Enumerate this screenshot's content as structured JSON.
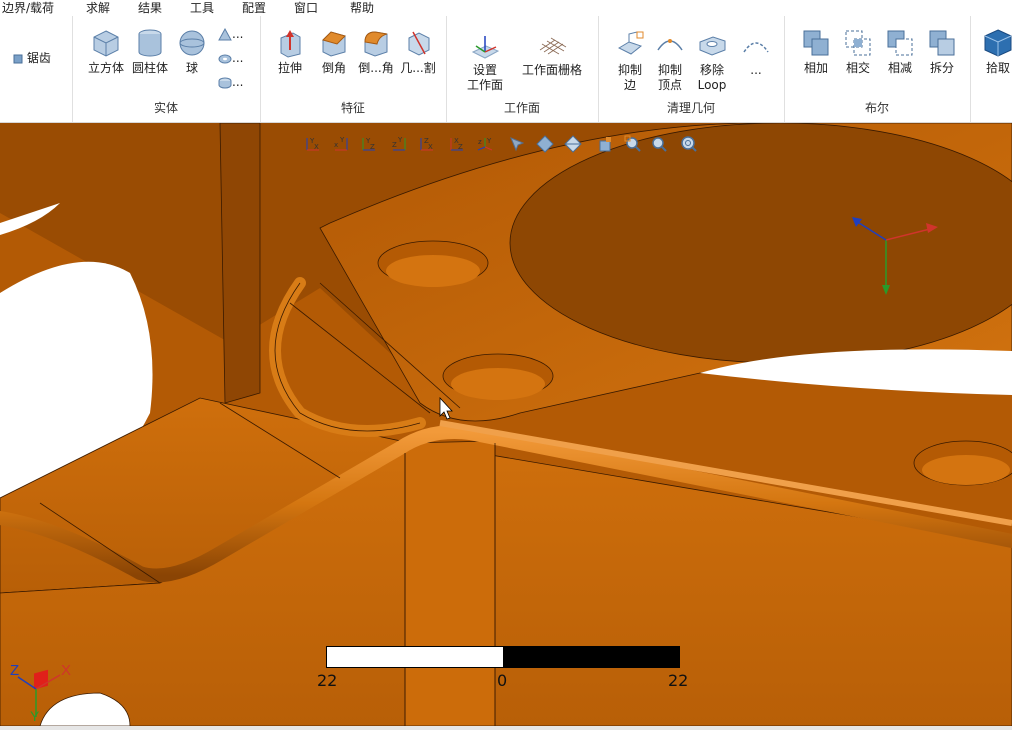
{
  "menu": [
    "边界/载荷",
    "求解",
    "结果",
    "工具",
    "配置",
    "窗口",
    "帮助"
  ],
  "ribbon": {
    "sawtooth": "锯齿",
    "solid": {
      "label": "实体",
      "tools": [
        "立方体",
        "圆柱体",
        "球"
      ],
      "more1": "...",
      "more2": "...",
      "more3": "..."
    },
    "feature": {
      "label": "特征",
      "tools": [
        "拉伸",
        "倒角",
        "倒...角",
        "几...割"
      ]
    },
    "workplane": {
      "label": "工作面",
      "set_line1": "设置",
      "set_line2": "工作面",
      "grid": "工作面栅格"
    },
    "cleanup": {
      "label": "清理几何",
      "t1_line1": "抑制",
      "t1_line2": "边",
      "t2_line1": "抑制",
      "t2_line2": "顶点",
      "t3_line1": "移除",
      "t3_line2": "Loop",
      "more": "..."
    },
    "boolean": {
      "label": "布尔",
      "tools": [
        "相加",
        "相交",
        "相减",
        "拆分"
      ]
    },
    "pick": "拾取"
  },
  "viewport": {
    "view_tools": [
      "view-yx-icon",
      "view-xy-icon",
      "view-yz-icon",
      "view-zy-icon",
      "view-zx-icon",
      "view-xz-icon",
      "view-iso-icon",
      "select-arrow-icon",
      "shade-icon",
      "wireframe-icon",
      "box-icon",
      "zoom-window-icon",
      "zoom-fit-icon",
      "zoom-all-icon"
    ],
    "triad": {
      "x": "X",
      "y": "Y",
      "z": "Z"
    },
    "scale": {
      "left": "22",
      "center": "0",
      "right": "22"
    }
  },
  "colors": {
    "model": "#c96b0b",
    "model_dark": "#8f4604",
    "model_light": "#e3882a",
    "background": "#ffffff",
    "edge": "#3a1a00"
  }
}
